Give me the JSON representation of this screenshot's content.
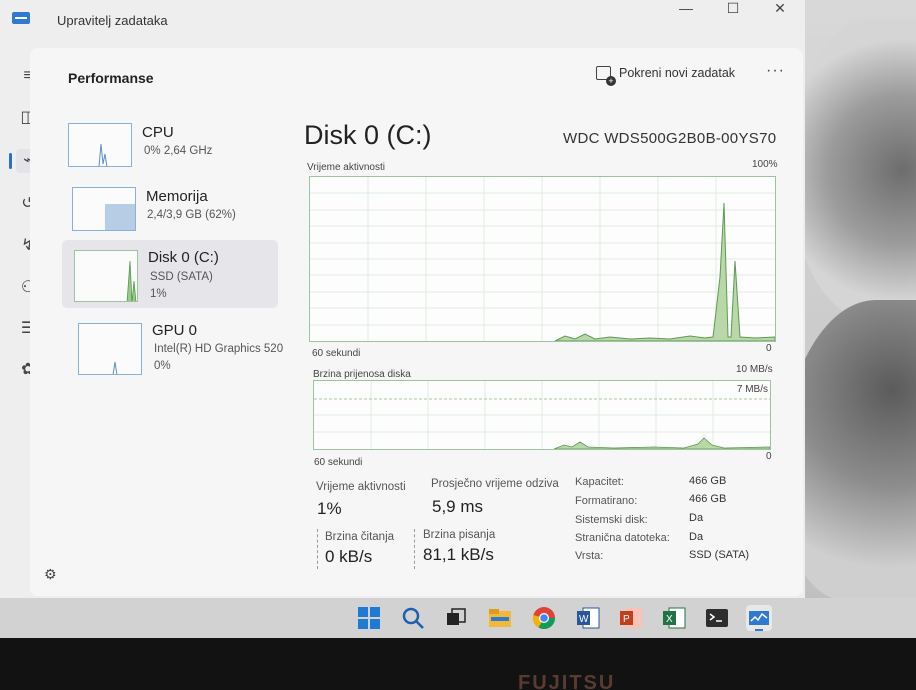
{
  "window": {
    "title": "Upravitelj zadataka",
    "controls": {
      "minimize": "—",
      "maximize": "☐",
      "close": "✕"
    }
  },
  "sidebar_icons": [
    "menu-icon",
    "processes-icon",
    "performance-icon",
    "history-icon",
    "startup-icon",
    "users-icon",
    "details-icon",
    "services-icon",
    "settings-icon"
  ],
  "header": {
    "page_title": "Performanse",
    "run_task_label": "Pokreni novi zadatak",
    "more_label": "···"
  },
  "resources": [
    {
      "name": "CPU",
      "line1": "0% 2,64 GHz",
      "line2": ""
    },
    {
      "name": "Memorija",
      "line1": "2,4/3,9 GB (62%)",
      "line2": ""
    },
    {
      "name": "Disk 0 (C:)",
      "line1": "SSD (SATA)",
      "line2": "1%"
    },
    {
      "name": "GPU 0",
      "line1": "Intel(R) HD Graphics 520",
      "line2": "0%"
    }
  ],
  "main": {
    "title": "Disk 0 (C:)",
    "model": "WDC  WDS500G2B0B-00YS70",
    "activity_graph": {
      "label": "Vrijeme aktivnosti",
      "max_label": "100%",
      "time_label": "60 sekundi",
      "min_label": "0"
    },
    "transfer_graph": {
      "label": "Brzina prijenosa diska",
      "max_label": "10 MB/s",
      "line_label": "7 MB/s",
      "time_label": "60 sekundi",
      "min_label": "0"
    },
    "stats": {
      "active_time_label": "Vrijeme aktivnosti",
      "active_time_value": "1%",
      "response_label": "Prosječno vrijeme odziva",
      "response_value": "5,9 ms",
      "read_label": "Brzina čitanja",
      "read_value": "0 kB/s",
      "write_label": "Brzina pisanja",
      "write_value": "81,1 kB/s"
    },
    "properties": [
      {
        "key": "Kapacitet:",
        "value": "466 GB"
      },
      {
        "key": "Formatirano:",
        "value": "466 GB"
      },
      {
        "key": "Sistemski disk:",
        "value": "Da"
      },
      {
        "key": "Stranična datoteka:",
        "value": "Da"
      },
      {
        "key": "Vrsta:",
        "value": "SSD (SATA)"
      }
    ]
  },
  "taskbar_icons": [
    "start-icon",
    "search-icon",
    "task-view-icon",
    "file-explorer-icon",
    "chrome-icon",
    "word-icon",
    "powerpoint-icon",
    "excel-icon",
    "terminal-icon",
    "task-manager-icon"
  ],
  "bezel_brand": "FUJITSU",
  "colors": {
    "accent_graph": "#9cc4a0",
    "graph_fill": "#b9d7a8",
    "cpu_line": "#5a8fc9"
  }
}
